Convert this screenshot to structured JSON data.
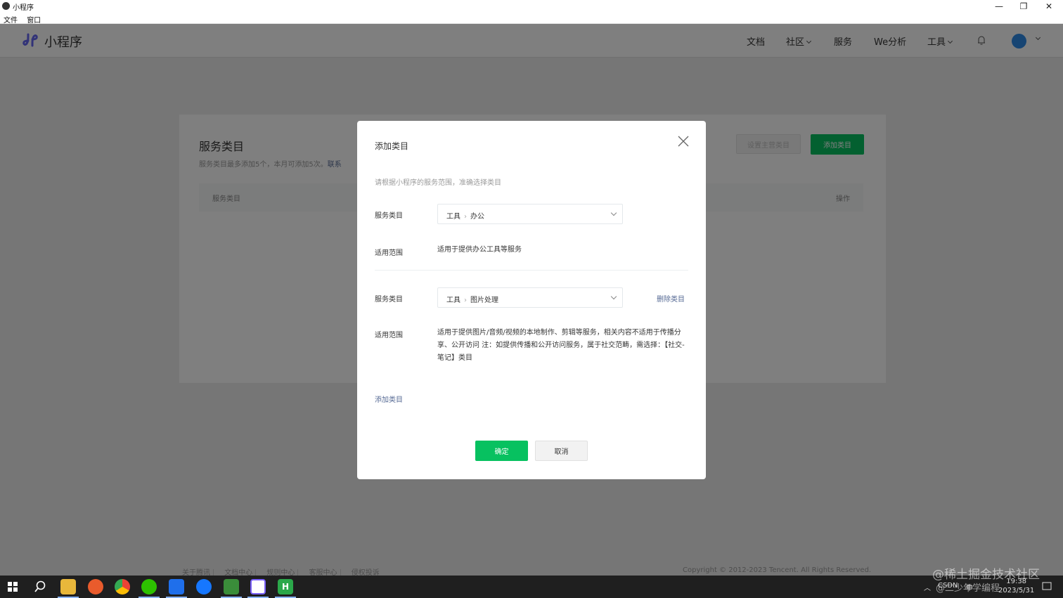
{
  "window": {
    "title": "小程序",
    "menu": [
      "文件",
      "窗口"
    ]
  },
  "header": {
    "brand": "小程序",
    "nav": {
      "docs": "文档",
      "community": "社区",
      "service": "服务",
      "analytics": "We分析",
      "tools": "工具"
    }
  },
  "page": {
    "title": "服务类目",
    "subtitle": "服务类目最多添加5个，本月可添加5次。",
    "subtitle_link": "联系",
    "set_primary_label": "设置主营类目",
    "add_category_label": "添加类目",
    "table_headers": [
      "服务类目",
      "操作"
    ]
  },
  "dialog": {
    "title": "添加类目",
    "hint": "请根据小程序的服务范围，准确选择类目",
    "items": [
      {
        "category_label": "服务类目",
        "path": [
          "工具",
          "办公"
        ],
        "scope_label": "适用范围",
        "scope": "适用于提供办公工具等服务"
      },
      {
        "category_label": "服务类目",
        "path": [
          "工具",
          "图片处理"
        ],
        "delete_label": "删除类目",
        "scope_label": "适用范围",
        "scope": "适用于提供图片/音频/视频的本地制作、剪辑等服务，相关内容不适用于传播分享、公开访问 注：如提供传播和公开访问服务，属于社交范畴，需选择：【社交-笔记】类目"
      }
    ],
    "add_label": "添加类目",
    "confirm_label": "确定",
    "cancel_label": "取消"
  },
  "footer": {
    "links": [
      "关于腾讯",
      "文档中心",
      "规则中心",
      "客服中心",
      "侵权投诉"
    ],
    "copyright": "Copyright © 2012-2023 Tencent. All Rights Reserved."
  },
  "taskbar": {
    "tray_text": "CSDN",
    "lang": "中",
    "time": "19:38",
    "date": "2023/5/31"
  },
  "watermark": {
    "line1": "@稀土掘金技术社区",
    "line2": "@二少年学编程"
  },
  "colors": {
    "accent_green": "#07c160",
    "link_blue": "#576b95",
    "mask": "rgba(0,0,0,0.5)"
  }
}
